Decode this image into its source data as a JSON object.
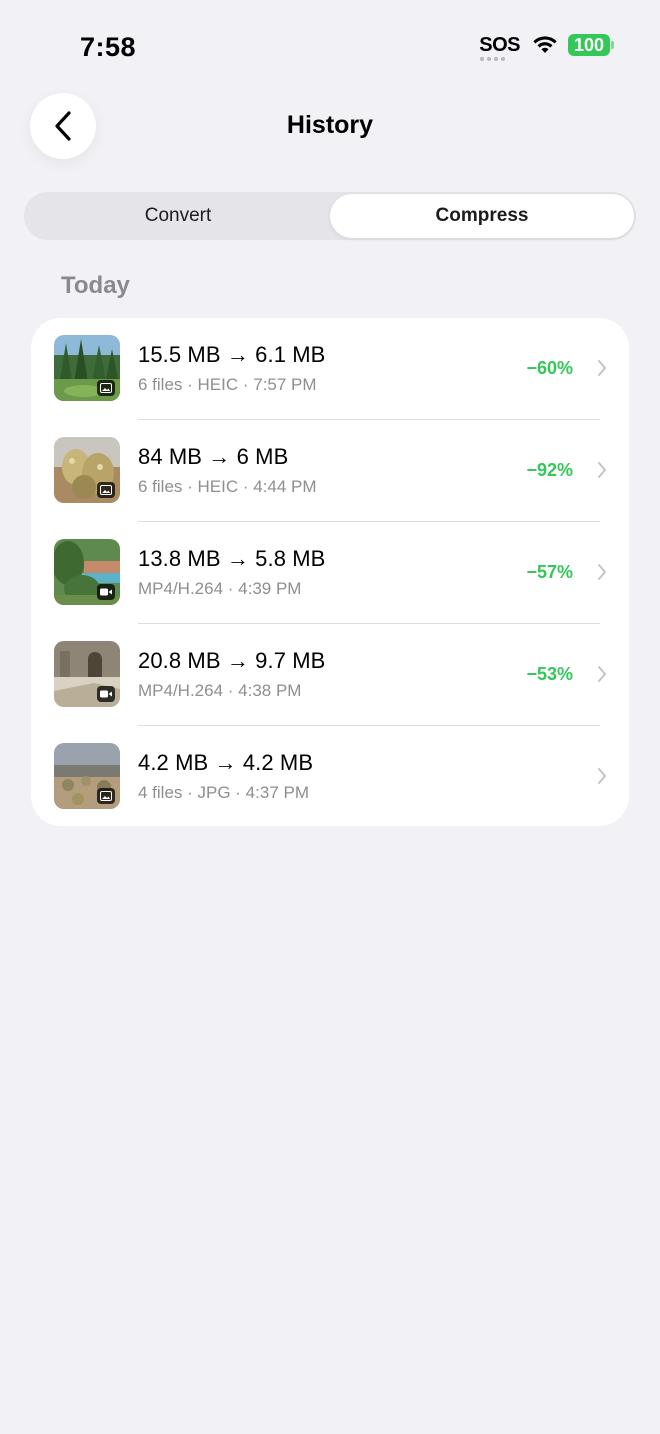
{
  "status_bar": {
    "time": "7:58",
    "sos": "SOS",
    "battery": "100",
    "battery_color": "#34c759"
  },
  "nav": {
    "title": "History",
    "back_icon": "chevron-left-icon"
  },
  "tabs": [
    {
      "label": "Convert",
      "active": false
    },
    {
      "label": "Compress",
      "active": true
    }
  ],
  "section": {
    "title": "Today"
  },
  "rows": [
    {
      "title": "15.5 MB → 6.1 MB",
      "subtitle": "6 files · HEIC · 7:57 PM",
      "percent": "−60%",
      "media": "photo-icon"
    },
    {
      "title": "84 MB → 6 MB",
      "subtitle": "6 files · HEIC · 4:44 PM",
      "percent": "−92%",
      "media": "photo-icon"
    },
    {
      "title": "13.8 MB → 5.8 MB",
      "subtitle": "MP4/H.264 · 4:39 PM",
      "percent": "−57%",
      "media": "video-icon"
    },
    {
      "title": "20.8 MB → 9.7 MB",
      "subtitle": "MP4/H.264 · 4:38 PM",
      "percent": "−53%",
      "media": "video-icon"
    },
    {
      "title": "4.2 MB → 4.2 MB",
      "subtitle": "4 files · JPG · 4:37 PM",
      "percent": "",
      "media": "photo-icon"
    }
  ],
  "colors": {
    "background": "#f1f1f6",
    "accent_green": "#34c759",
    "secondary_text": "#8e8e93"
  }
}
